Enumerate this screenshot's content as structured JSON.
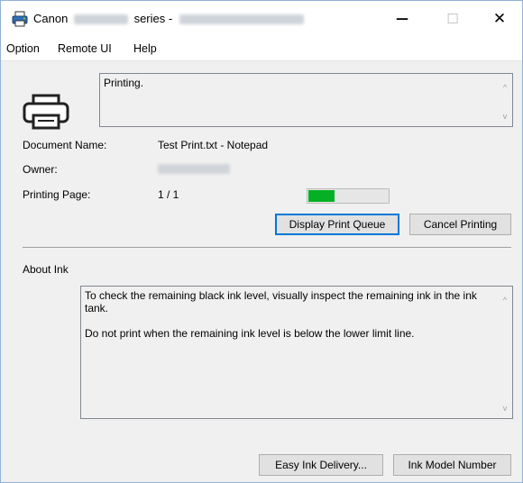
{
  "window": {
    "title_prefix": "Canon",
    "title_suffix": "series -",
    "minimize_glyph": "—",
    "maximize_glyph": "☐",
    "close_glyph": "✕"
  },
  "menu": {
    "items": [
      "Option",
      "Remote UI",
      "Help"
    ]
  },
  "status": {
    "message": "Printing.",
    "scroll_up": "^",
    "scroll_down": "v"
  },
  "details": {
    "document_name_label": "Document Name:",
    "document_name_value": "Test Print.txt - Notepad",
    "owner_label": "Owner:",
    "printing_page_label": "Printing Page:",
    "printing_page_value": "1 / 1",
    "progress_percent": 33
  },
  "buttons": {
    "display_print_queue": "Display Print Queue",
    "cancel_printing": "Cancel Printing",
    "easy_ink_delivery": "Easy Ink Delivery...",
    "ink_model_number": "Ink Model Number"
  },
  "about_ink": {
    "heading": "About Ink",
    "line1": "To check the remaining black ink level, visually inspect the remaining ink in the ink tank.",
    "line2": "Do not print when the remaining ink level is below the lower limit line.",
    "scroll_up": "^",
    "scroll_down": "v"
  },
  "icons": {
    "app": "printer-app-icon",
    "status": "printer-icon"
  },
  "colors": {
    "progress": "#06b025",
    "default_button_border": "#0078d7"
  }
}
